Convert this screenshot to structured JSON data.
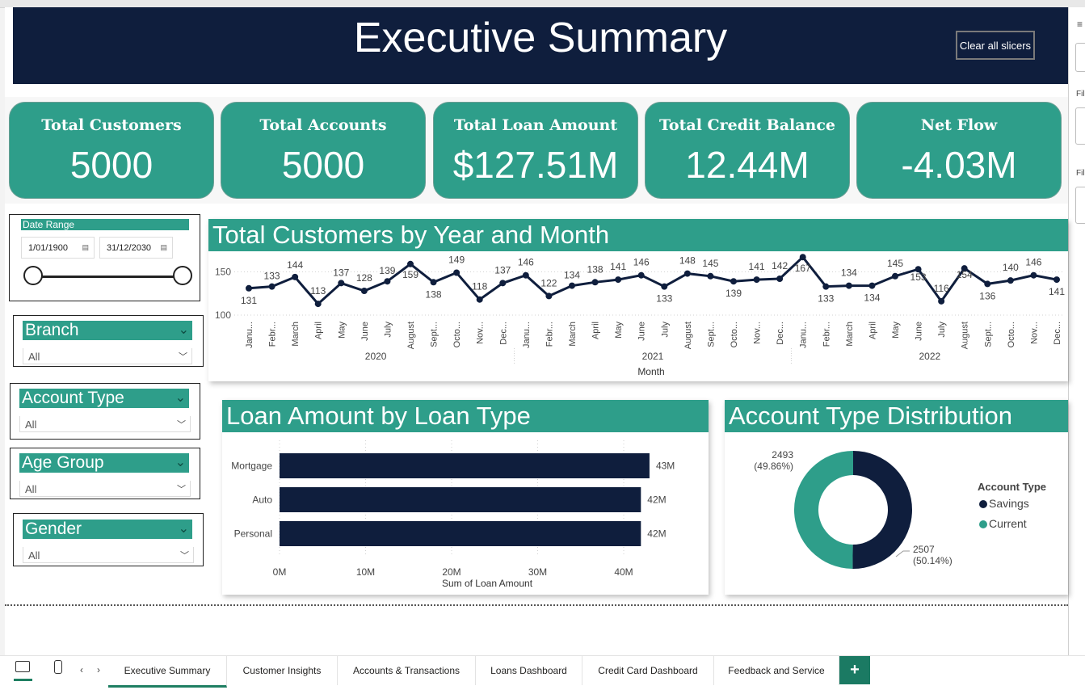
{
  "header": {
    "title": "Executive Summary",
    "clear_button": "Clear all slicers"
  },
  "kpis": [
    {
      "label": "Total Customers",
      "value": "5000"
    },
    {
      "label": "Total Accounts",
      "value": "5000"
    },
    {
      "label": "Total Loan Amount",
      "value": "$127.51M"
    },
    {
      "label": "Total Credit Balance",
      "value": "12.44M"
    },
    {
      "label": "Net Flow",
      "value": "-4.03M"
    }
  ],
  "date_slicer": {
    "title": "Date Range",
    "start": "1/01/1900",
    "end": "31/12/2030"
  },
  "slicers": [
    {
      "title": "Branch",
      "value": "All"
    },
    {
      "title": "Account Type",
      "value": "All"
    },
    {
      "title": "Age Group",
      "value": "All"
    },
    {
      "title": "Gender",
      "value": "All"
    }
  ],
  "colors": {
    "navy": "#0f1e3d",
    "teal": "#2e9e8a",
    "tab_accent": "#1f7f62"
  },
  "chart_data": [
    {
      "type": "line",
      "title": "Total Customers by Year and Month",
      "xlabel": "Month",
      "ylim": [
        100,
        170
      ],
      "y_ticks": [
        100,
        150
      ],
      "years": [
        "2020",
        "2021",
        "2022"
      ],
      "months": [
        "January",
        "February",
        "March",
        "April",
        "May",
        "June",
        "July",
        "August",
        "September",
        "October",
        "November",
        "December"
      ],
      "month_tick_labels": [
        "Janu...",
        "Febr...",
        "March",
        "April",
        "May",
        "June",
        "July",
        "August",
        "Sept...",
        "Octo...",
        "Nov...",
        "Dec..."
      ],
      "values": [
        131,
        133,
        144,
        113,
        137,
        128,
        139,
        159,
        138,
        149,
        118,
        137,
        146,
        122,
        134,
        138,
        141,
        146,
        133,
        148,
        145,
        139,
        141,
        142,
        167,
        133,
        134,
        134,
        145,
        153,
        116,
        154,
        136,
        140,
        146,
        141
      ],
      "color": "#0f1e3d"
    },
    {
      "type": "bar",
      "orientation": "horizontal",
      "title": "Loan Amount by Loan Type",
      "categories": [
        "Mortgage",
        "Auto",
        "Personal"
      ],
      "values": [
        43,
        42,
        42
      ],
      "value_labels": [
        "43M",
        "42M",
        "42M"
      ],
      "xlabel": "Sum of Loan Amount",
      "x_ticks": [
        "0M",
        "10M",
        "20M",
        "30M",
        "40M"
      ],
      "xlim": [
        0,
        40
      ],
      "color": "#0f1e3d"
    },
    {
      "type": "pie",
      "donut": true,
      "title": "Account Type Distribution",
      "legend_title": "Account Type",
      "slices": [
        {
          "name": "Savings",
          "value": 2507,
          "label": "2507",
          "pct": "(50.14%)",
          "color": "#0f1e3d"
        },
        {
          "name": "Current",
          "value": 2493,
          "label": "2493",
          "pct": "(49.86%)",
          "color": "#2e9e8a"
        }
      ]
    }
  ],
  "tabs": [
    {
      "label": "Executive Summary",
      "active": true
    },
    {
      "label": "Customer Insights"
    },
    {
      "label": "Accounts & Transactions"
    },
    {
      "label": "Loans Dashboard"
    },
    {
      "label": "Credit Card Dashboard"
    },
    {
      "label": "Feedback and Service"
    }
  ],
  "add_tab": "+"
}
